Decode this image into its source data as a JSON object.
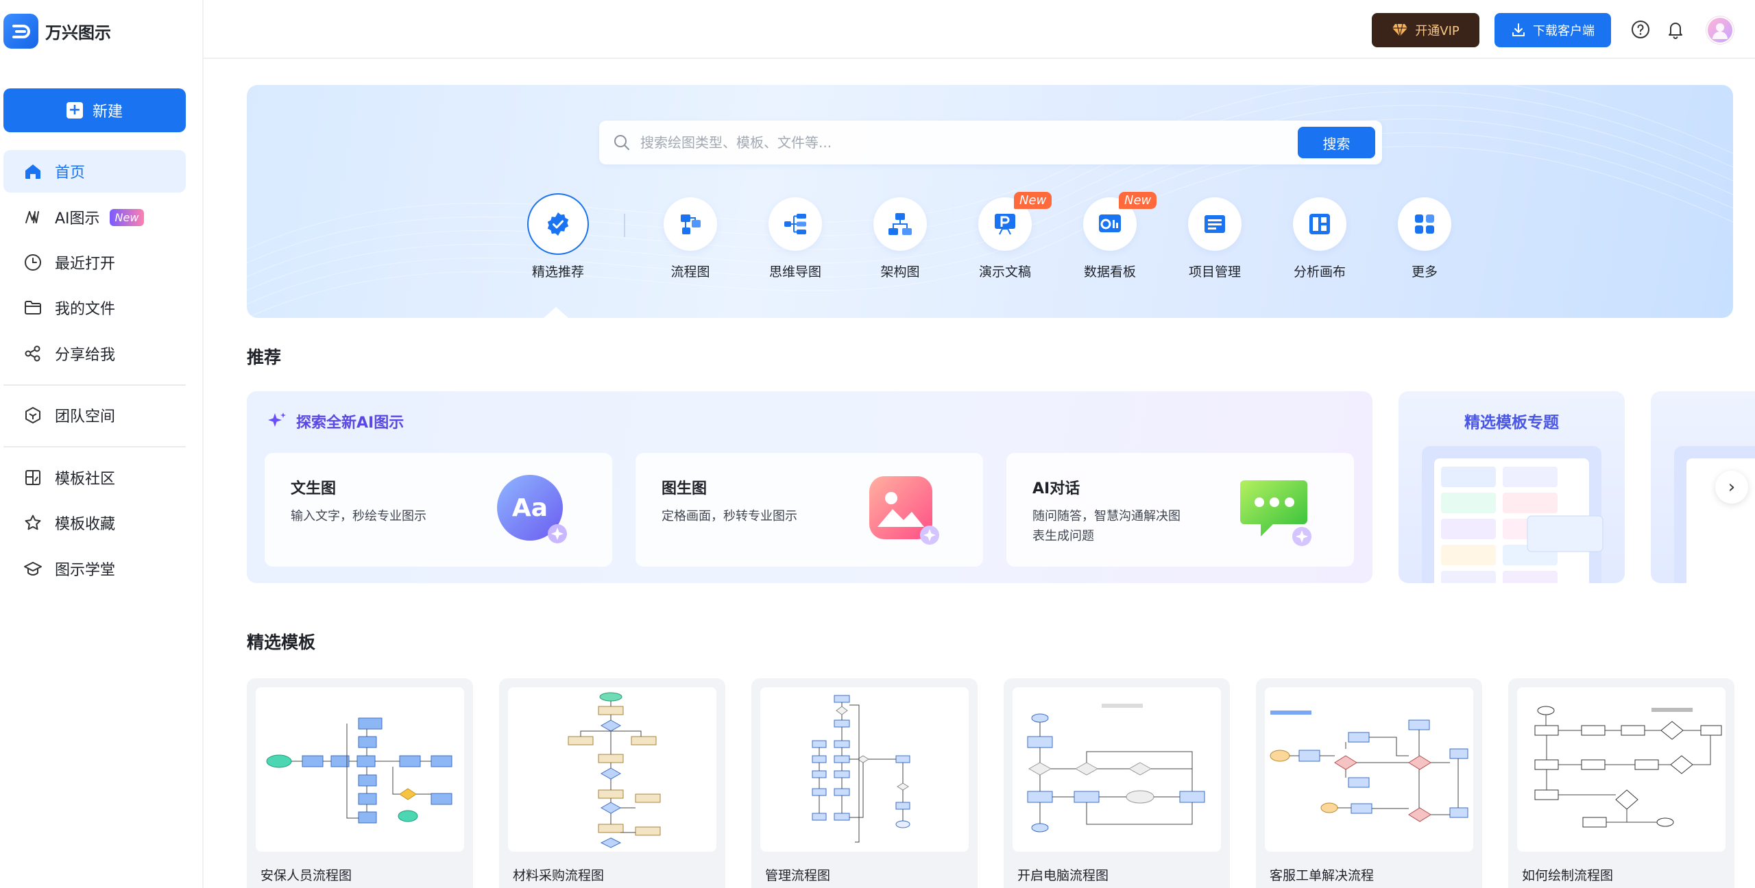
{
  "app": {
    "name": "万兴图示"
  },
  "sidebar": {
    "new_label": "新建",
    "items": [
      {
        "label": "首页",
        "icon": "home-icon",
        "active": true
      },
      {
        "label": "AI图示",
        "icon": "ai-icon",
        "badge": "New"
      },
      {
        "label": "最近打开",
        "icon": "clock-icon"
      },
      {
        "label": "我的文件",
        "icon": "folder-icon"
      },
      {
        "label": "分享给我",
        "icon": "share-icon"
      },
      {
        "label": "团队空间",
        "icon": "cube-icon"
      },
      {
        "label": "模板社区",
        "icon": "template-icon"
      },
      {
        "label": "模板收藏",
        "icon": "star-icon"
      },
      {
        "label": "图示学堂",
        "icon": "graduation-cap-icon"
      }
    ]
  },
  "topbar": {
    "vip_label": "开通VIP",
    "download_label": "下载客户端"
  },
  "hero": {
    "search_placeholder": "搜索绘图类型、模板、文件等...",
    "search_button": "搜索",
    "categories": [
      {
        "label": "精选推荐",
        "icon": "badge-check-icon",
        "active": true
      },
      {
        "label": "流程图",
        "icon": "flowchart-icon"
      },
      {
        "label": "思维导图",
        "icon": "mindmap-icon"
      },
      {
        "label": "架构图",
        "icon": "org-chart-icon"
      },
      {
        "label": "演示文稿",
        "icon": "presentation-icon",
        "badge": "New"
      },
      {
        "label": "数据看板",
        "icon": "dashboard-icon",
        "badge": "New"
      },
      {
        "label": "项目管理",
        "icon": "project-icon"
      },
      {
        "label": "分析画布",
        "icon": "canvas-icon"
      },
      {
        "label": "更多",
        "icon": "grid-icon"
      }
    ]
  },
  "recommend": {
    "title": "推荐",
    "ai_title": "探索全新AI图示",
    "cards": [
      {
        "title": "文生图",
        "desc": "输入文字，秒绘专业图示",
        "art": "Aa"
      },
      {
        "title": "图生图",
        "desc": "定格画面，秒转专业图示"
      },
      {
        "title": "AI对话",
        "desc": "随问随答，智慧沟通解决图表生成问题"
      }
    ],
    "topic_title": "精选模板专题"
  },
  "templates": {
    "title": "精选模板",
    "items": [
      {
        "name": "安保人员流程图"
      },
      {
        "name": "材料采购流程图"
      },
      {
        "name": "管理流程图"
      },
      {
        "name": "开启电脑流程图"
      },
      {
        "name": "客服工单解决流程"
      },
      {
        "name": "如何绘制流程图"
      }
    ]
  },
  "colors": {
    "accent": "#1a73f0",
    "vip_bg": "#3a2319",
    "vip_text": "#f7c889",
    "new_badge": "#ff6a3d"
  }
}
